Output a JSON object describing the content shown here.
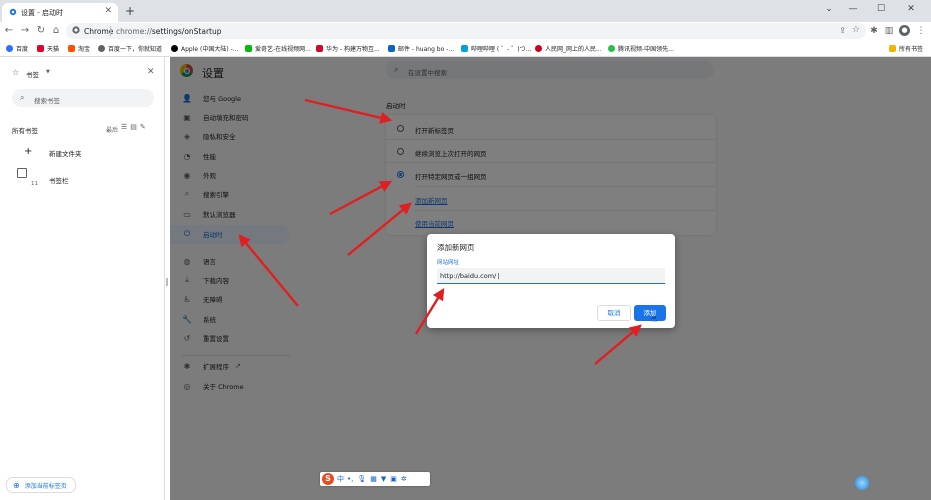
{
  "browser": {
    "tab_title": "设置 - 启动时",
    "tab_close": "✕",
    "new_tab": "+",
    "window_controls": [
      "⌄",
      "—",
      "☐",
      "✕"
    ],
    "nav": {
      "back": "←",
      "forward": "→",
      "reload": "↻",
      "home": "⌂"
    },
    "omnibox": {
      "site": "Chrome",
      "url_host": "chrome://",
      "url_path": "settings/onStartup"
    }
  },
  "bookmarks_bar": {
    "items": [
      {
        "label": "百度",
        "color": "#306cff"
      },
      {
        "label": "天猫",
        "color": "#e4002b"
      },
      {
        "label": "淘宝",
        "color": "#ff5000"
      },
      {
        "label": "百度一下，你就知道",
        "color": "#5f6368"
      },
      {
        "label": "Apple (中国大陆) -...",
        "color": "#000000"
      },
      {
        "label": "爱奇艺-在线视频网...",
        "color": "#00be06"
      },
      {
        "label": "华为 - 构建万物互...",
        "color": "#cf0a2c"
      },
      {
        "label": "邮件 - huang bo -...",
        "color": "#0a66c2"
      },
      {
        "label": "哔哩哔哩 ( ゜- ゜)つ...",
        "color": "#00a1d6"
      },
      {
        "label": "人民网_网上的人民...",
        "color": "#d0021b"
      },
      {
        "label": "腾讯视频-中国领先...",
        "color": "#27c14b"
      }
    ],
    "all_bookmarks": "所有书签"
  },
  "bookmark_panel": {
    "title": "书签",
    "search_placeholder": "搜索书签",
    "all_label": "所有书签",
    "sort_label": "最后",
    "new_folder": "新建文件夹",
    "bookmark_bar": "书签栏",
    "bookmark_bar_count": "11",
    "add_current": "添加当前标签页"
  },
  "settings": {
    "title": "设置",
    "search_placeholder": "在设置中搜索",
    "nav": [
      {
        "label": "您与 Google",
        "icon": "👤"
      },
      {
        "label": "自动填充和密码",
        "icon": "▣"
      },
      {
        "label": "隐私和安全",
        "icon": "◈"
      },
      {
        "label": "性能",
        "icon": "◔"
      },
      {
        "label": "外观",
        "icon": "◉"
      },
      {
        "label": "搜索引擎",
        "icon": "⌕"
      },
      {
        "label": "默认浏览器",
        "icon": "▭"
      },
      {
        "label": "启动时",
        "icon": "⏻"
      },
      {
        "label": "语言",
        "icon": "◍"
      },
      {
        "label": "下载内容",
        "icon": "⤓"
      },
      {
        "label": "无障碍",
        "icon": "♿"
      },
      {
        "label": "系统",
        "icon": "🔧"
      },
      {
        "label": "重置设置",
        "icon": "↺"
      },
      {
        "label": "扩展程序",
        "icon": "✱"
      },
      {
        "label": "关于 Chrome",
        "icon": "◎"
      }
    ],
    "startup": {
      "label": "启动时",
      "options": [
        {
          "label": "打开新标签页",
          "checked": false
        },
        {
          "label": "继续浏览上次打开的网页",
          "checked": false
        },
        {
          "label": "打开特定网页或一组网页",
          "checked": true
        }
      ],
      "add_page": "添加新网页",
      "use_current": "使用当前网页"
    }
  },
  "dialog": {
    "title": "添加新网页",
    "field_label": "网站网址",
    "field_value": "http://baidu.com/",
    "cancel": "取消",
    "add": "添加"
  },
  "colors": {
    "accent": "#1a73e8",
    "arrow": "#e02020"
  }
}
